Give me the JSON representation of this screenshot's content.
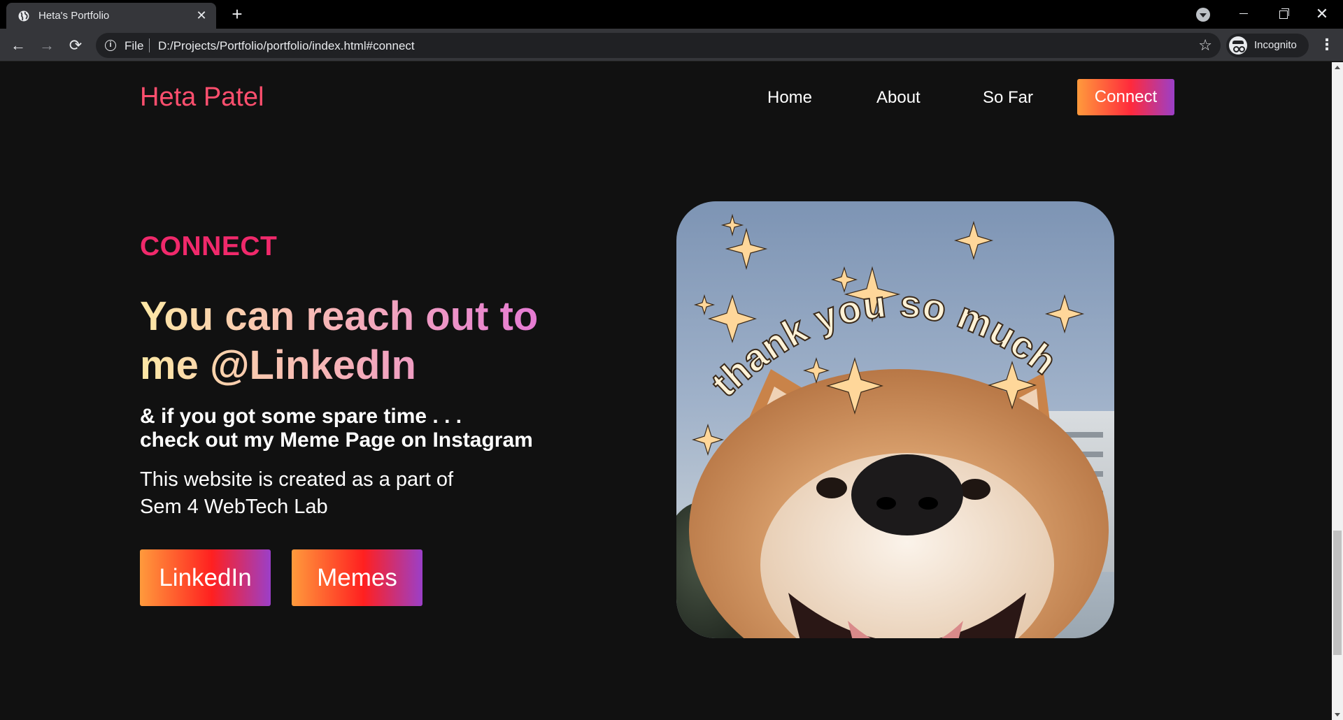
{
  "browser": {
    "tab_title": "Heta's Portfolio",
    "tab_close": "✕",
    "new_tab": "+",
    "url_scheme": "File",
    "url": "D:/Projects/Portfolio/portfolio/index.html#connect",
    "incognito_label": "Incognito"
  },
  "nav": {
    "brand": "Heta Patel",
    "links": [
      "Home",
      "About",
      "So Far"
    ],
    "active": "Connect"
  },
  "connect": {
    "eyebrow": "CONNECT",
    "headline": "You can reach out to me @LinkedIn",
    "sub_line1": "& if you got some spare time . . .",
    "sub_line2": "check out my Meme Page on Instagram",
    "note_line1": "This website is created as a part of",
    "note_line2": "Sem 4 WebTech Lab",
    "buttons": [
      "LinkedIn",
      "Memes"
    ]
  },
  "image": {
    "caption": "thank you so much"
  },
  "colors": {
    "brand": "#ff4f6e",
    "eyebrow": "#f0296b",
    "button_gradient": [
      "#ff9a3c",
      "#ff2a3c",
      "#9b3fc8"
    ],
    "background": "#111111"
  }
}
